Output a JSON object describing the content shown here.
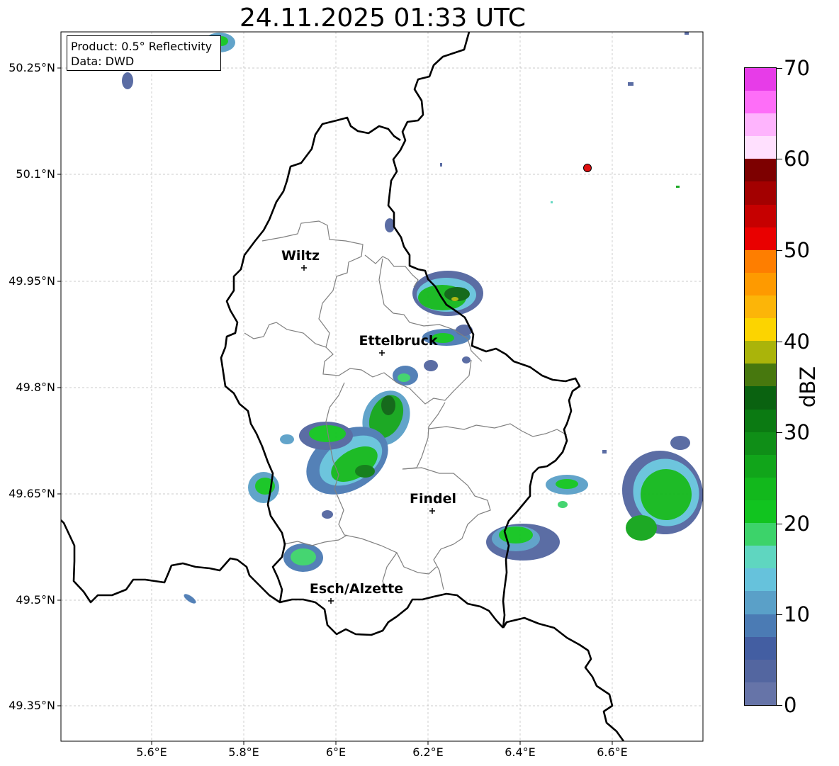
{
  "title": "24.11.2025 01:33 UTC",
  "infobox": {
    "product": "Product: 0.5° Reflectivity",
    "source": "Data: DWD"
  },
  "axes": {
    "lat_ticks": [
      "50.25°N",
      "50.1°N",
      "49.95°N",
      "49.8°N",
      "49.65°N",
      "49.5°N",
      "49.35°N"
    ],
    "lon_ticks": [
      "5.6°E",
      "5.8°E",
      "6°E",
      "6.2°E",
      "6.4°E",
      "6.6°E"
    ],
    "lon_range": [
      5.4,
      6.8
    ],
    "lat_range": [
      49.3,
      50.3
    ],
    "grid": true
  },
  "cities": [
    {
      "name": "Wiltz",
      "lon": 5.93,
      "lat": 49.968
    },
    {
      "name": "Ettelbruck",
      "lon": 6.103,
      "lat": 49.848
    },
    {
      "name": "Findel",
      "lon": 6.21,
      "lat": 49.627
    },
    {
      "name": "Esch/Alzette",
      "lon": 5.99,
      "lat": 49.498
    }
  ],
  "radar_site": {
    "lon": 6.548,
    "lat": 50.11,
    "color": "#e01010"
  },
  "colorbar": {
    "label": "dBZ",
    "ticks": [
      "0",
      "10",
      "20",
      "30",
      "40",
      "50",
      "60",
      "70"
    ],
    "min": 0,
    "max": 70,
    "colors": [
      "#6674a8",
      "#5366a0",
      "#435ea2",
      "#4b7bb4",
      "#5aa0c8",
      "#66c2dc",
      "#5fd6c0",
      "#3cd36a",
      "#11c41f",
      "#12b81c",
      "#11a51a",
      "#0f8e17",
      "#0b7a12",
      "#0a6210",
      "#47780e",
      "#aab40a",
      "#fcd400",
      "#fcb508",
      "#fe9a00",
      "#fe7e00",
      "#e90000",
      "#c60000",
      "#a30000",
      "#7d0000",
      "#ffe0fe",
      "#feb4fd",
      "#fe6ef8",
      "#e73ce8"
    ]
  }
}
